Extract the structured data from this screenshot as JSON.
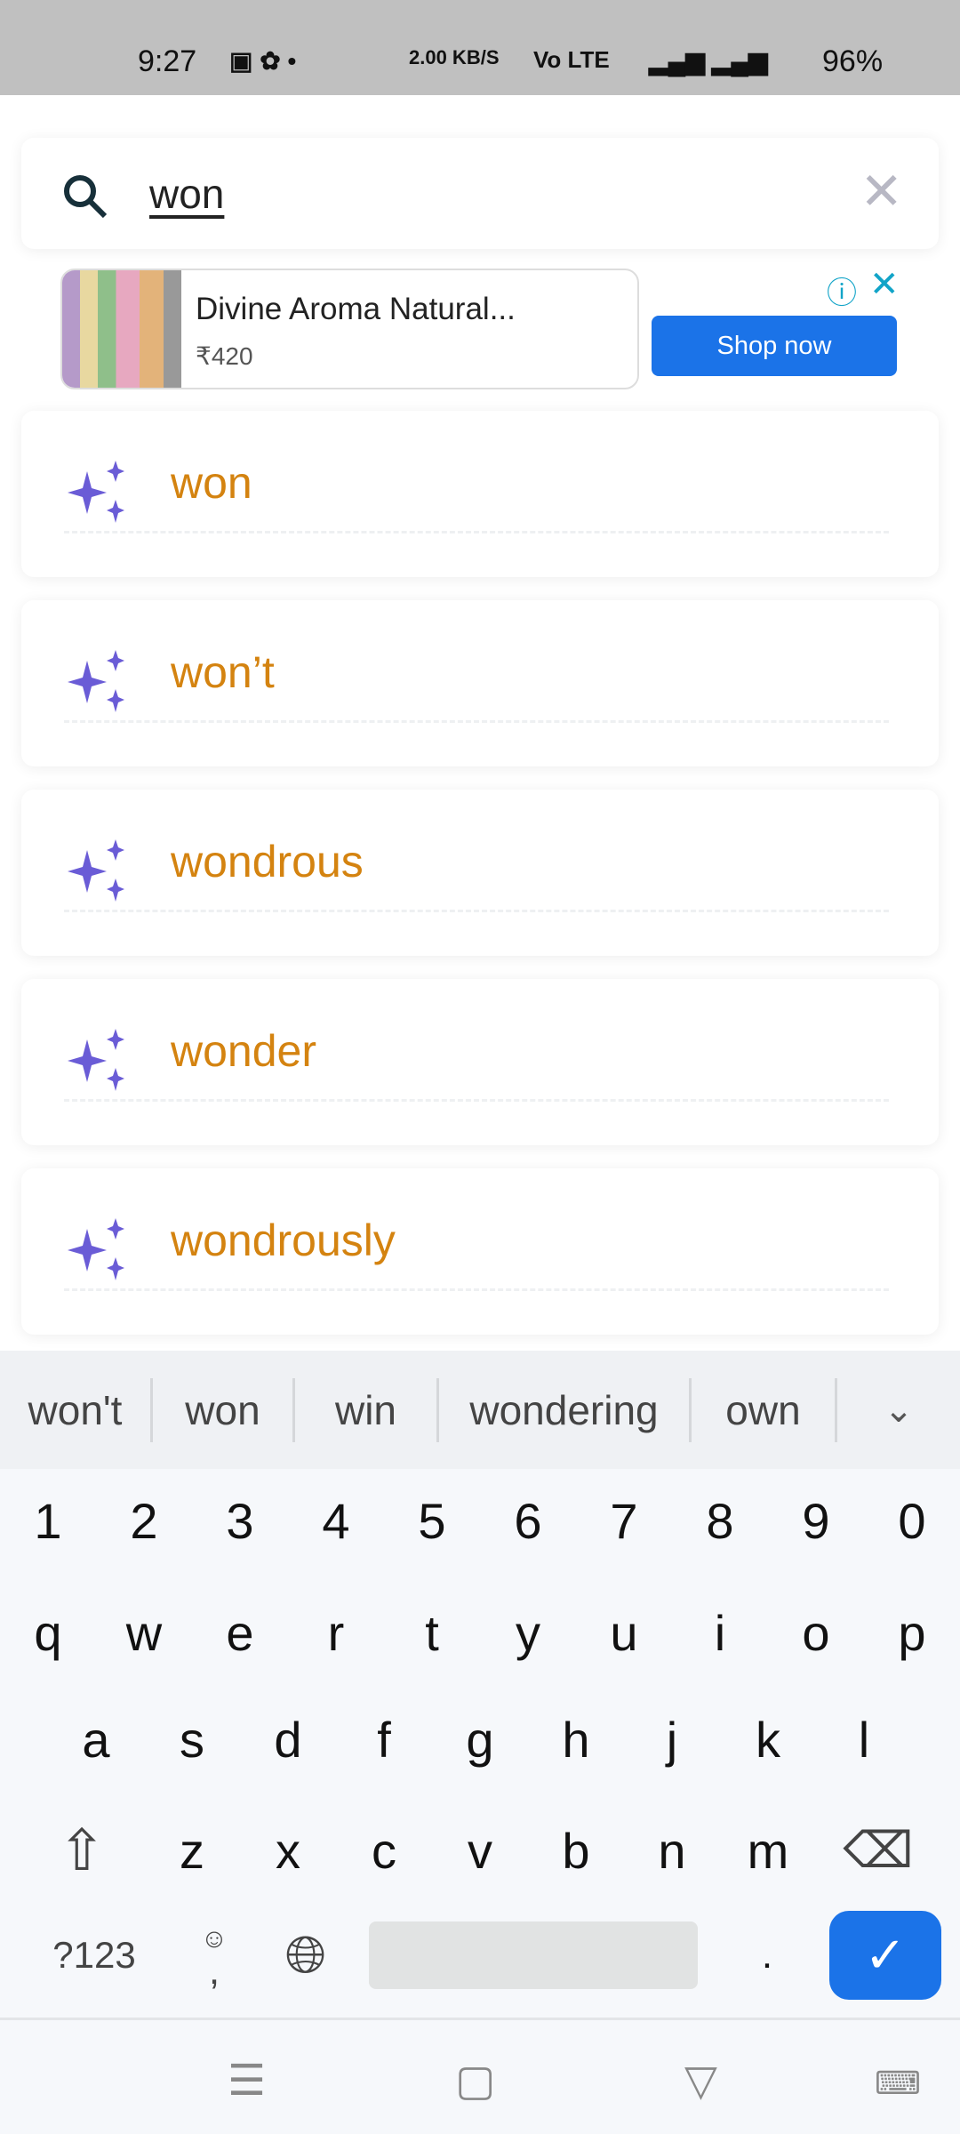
{
  "status_bar": {
    "time": "9:27",
    "net_speed": "2.00 KB/S",
    "volte": "Vo LTE",
    "battery": "96%"
  },
  "search": {
    "query": "won",
    "icon": "search-icon",
    "clear_icon": "close-icon"
  },
  "ad": {
    "title": "Divine Aroma Natural...",
    "price": "₹420",
    "cta": "Shop now",
    "info_icon": "info-icon",
    "close_icon": "close-icon"
  },
  "accent": {
    "word_color": "#d48310",
    "sparkle_color": "#6a5cd6",
    "button_color": "#1b73e8"
  },
  "results": [
    {
      "word": "won"
    },
    {
      "word": "won’t"
    },
    {
      "word": "wondrous"
    },
    {
      "word": "wonder"
    },
    {
      "word": "wondrously"
    }
  ],
  "keyboard": {
    "suggestions": [
      "won't",
      "won",
      "win",
      "wondering",
      "own"
    ],
    "numbers": [
      "1",
      "2",
      "3",
      "4",
      "5",
      "6",
      "7",
      "8",
      "9",
      "0"
    ],
    "row1": [
      "q",
      "w",
      "e",
      "r",
      "t",
      "y",
      "u",
      "i",
      "o",
      "p"
    ],
    "row2": [
      "a",
      "s",
      "d",
      "f",
      "g",
      "h",
      "j",
      "k",
      "l"
    ],
    "row3": [
      "z",
      "x",
      "c",
      "v",
      "b",
      "n",
      "m"
    ],
    "symbols_label": "?123",
    "comma": ",",
    "period": "."
  }
}
